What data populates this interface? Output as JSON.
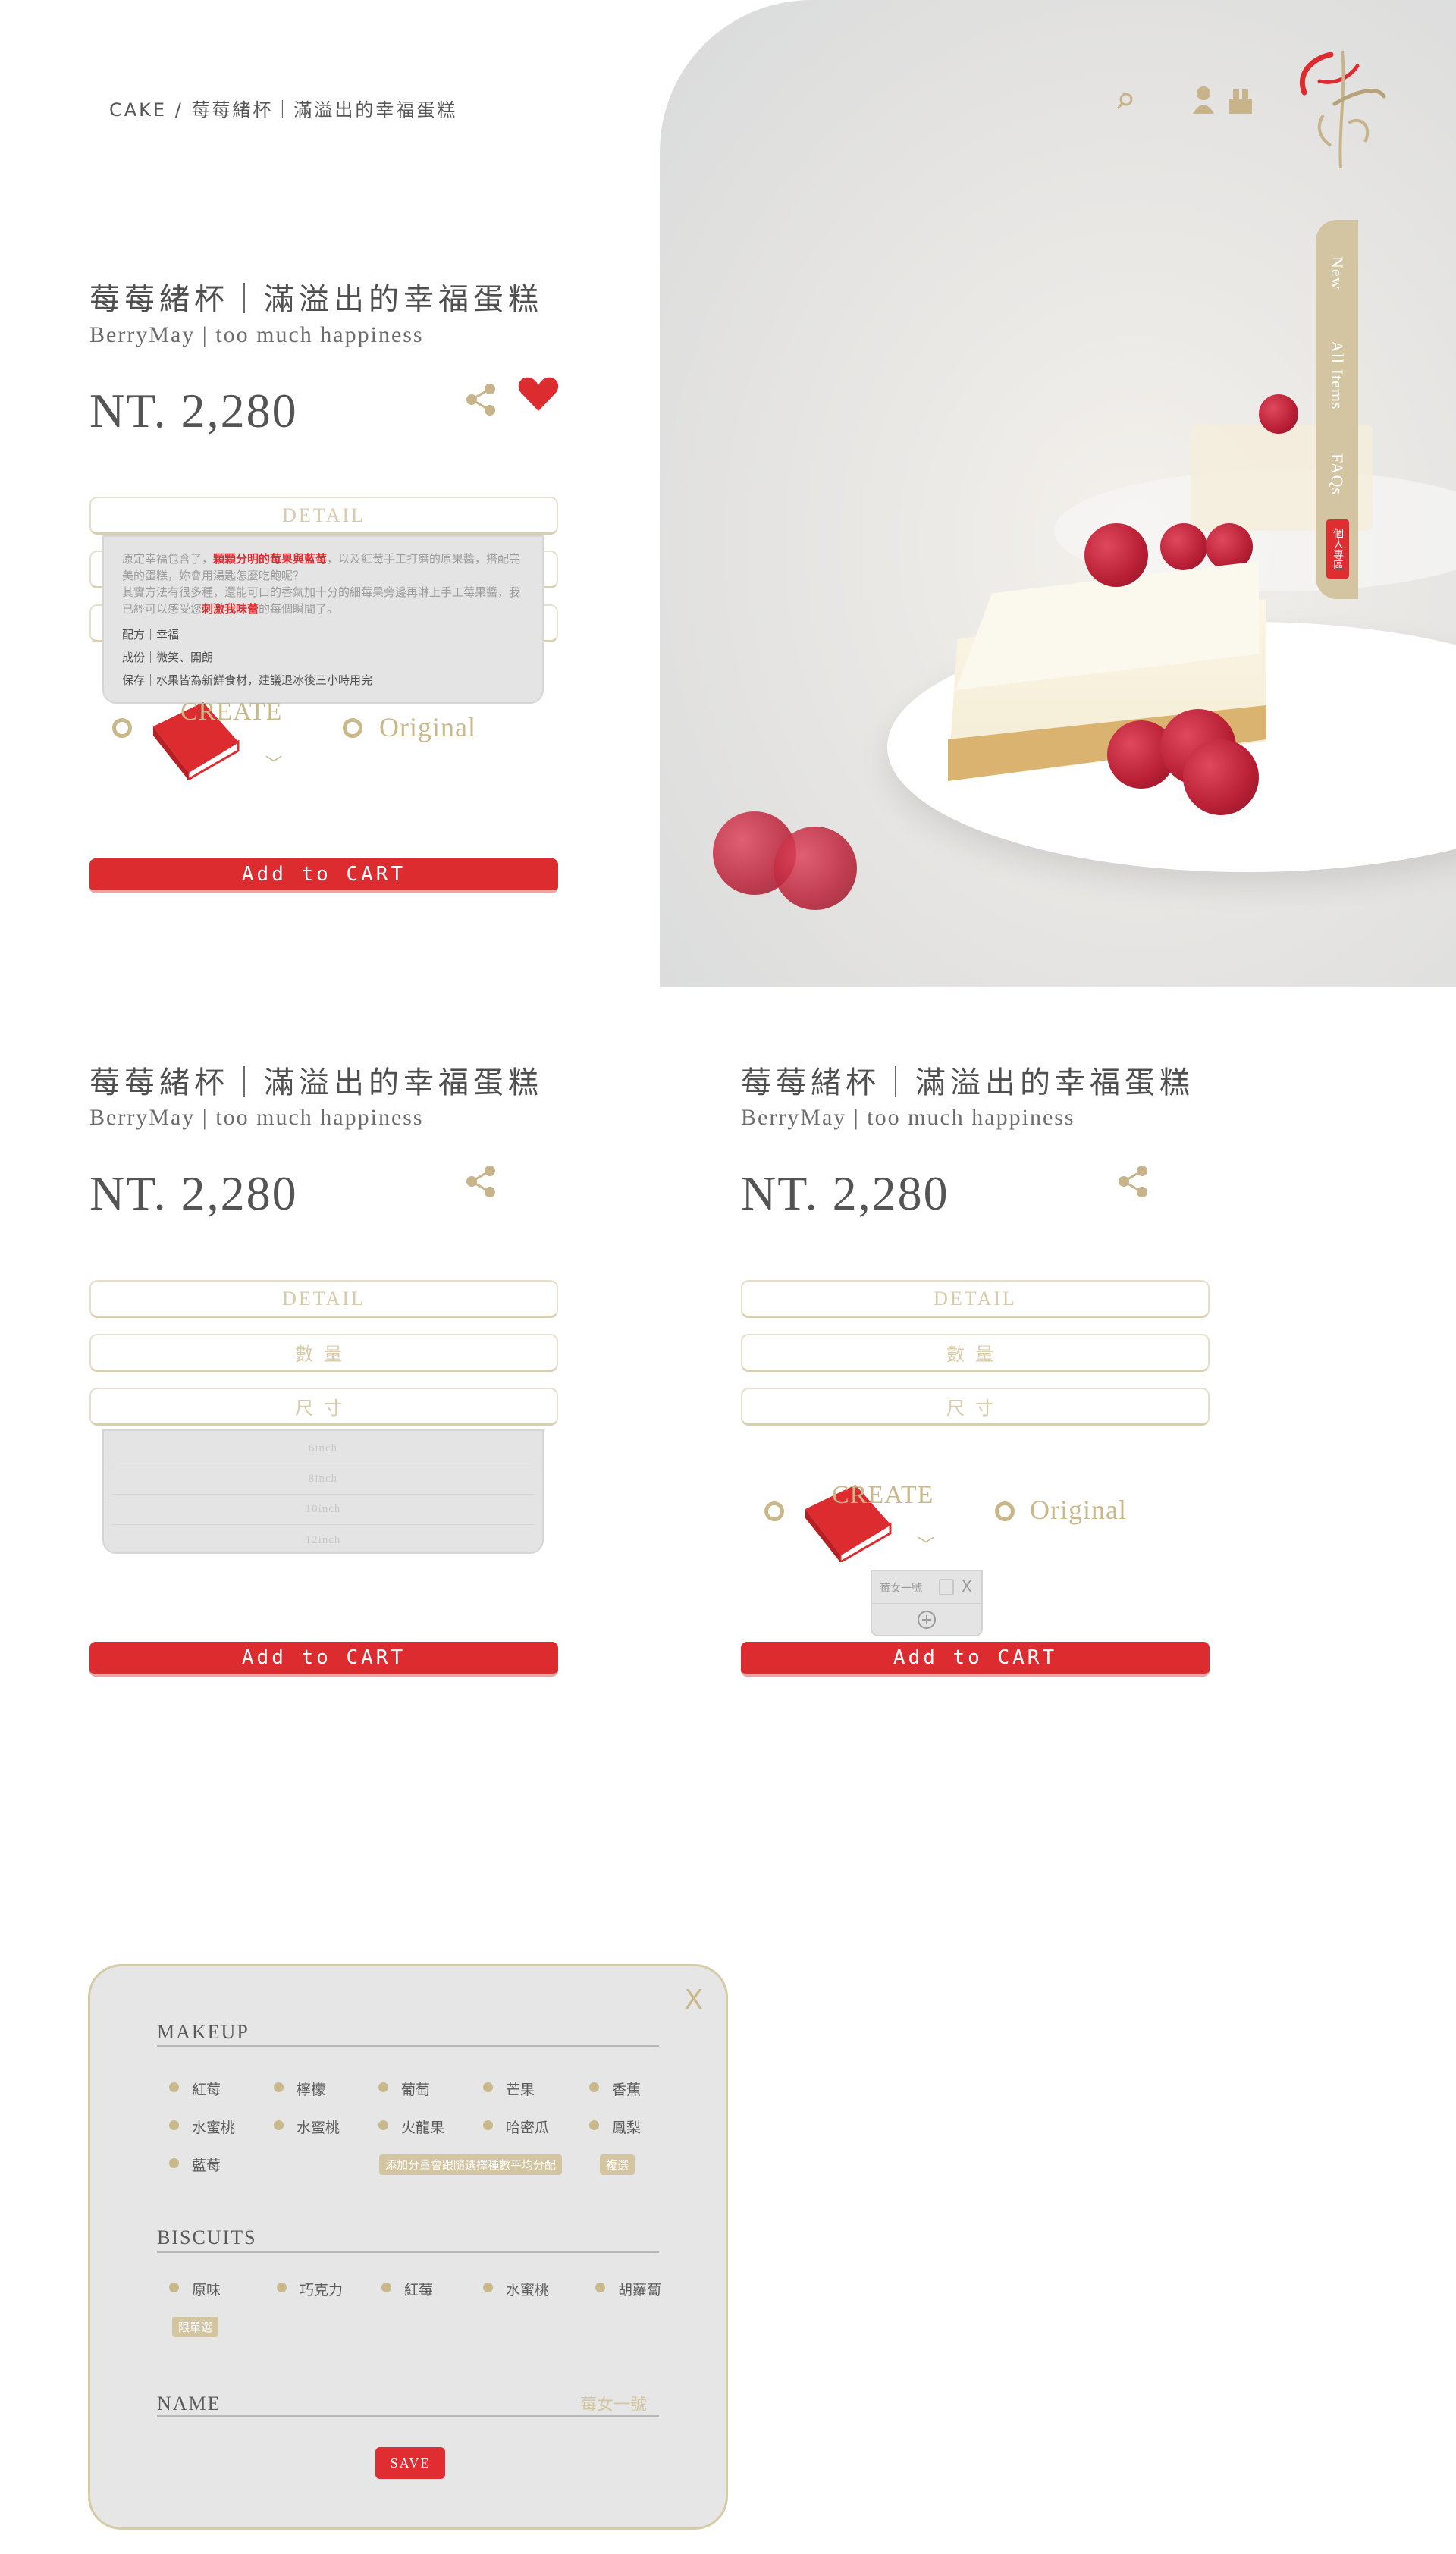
{
  "breadcrumb": "CAKE / 莓莓緒杯｜滿溢出的幸福蛋糕",
  "header": {
    "search_icon": "search-icon",
    "user_icon": "user-icon",
    "cart_icon": "cart-icon"
  },
  "sidenav": {
    "items": [
      "New",
      "All Items",
      "FAQs"
    ],
    "badge": "個人專區"
  },
  "hero": {
    "slides_total": 4
  },
  "product": {
    "title": "莓莓緒杯｜滿溢出的幸福蛋糕",
    "subtitle": "BerryMay | too much happiness",
    "price": "NT. 2,280",
    "detail_label": "DETAIL",
    "quantity_label": "數量",
    "size_label": "尺寸",
    "create_label": "CREATE",
    "original_label": "Original",
    "cart_label": "Add to CART"
  },
  "detail_popup": {
    "para1_a": "原定幸福包含了，",
    "para1_hl": "顆顆分明的莓果與藍莓",
    "para1_b": "，以及紅莓手工打磨的原果醬，搭配完美的蛋糕，妳會用湯匙怎麼吃飽呢？",
    "para2_a": "其實方法有很多種，還能可口的香氣加十分的細莓果旁邊再淋上手工莓果醬，我已經可以感受您",
    "para2_hl": "刺激我味蕾",
    "para2_b": "的每個瞬間了。",
    "recipe": "配方｜幸福",
    "ingredients": "成份｜微笑、開朗",
    "storage": "保存｜水果皆為新鮮食材，建議退冰後三小時用完"
  },
  "size_options": [
    "6inch",
    "8inch",
    "10inch",
    "12inch"
  ],
  "mini_popup": {
    "name": "莓女一號",
    "close": "X"
  },
  "editor": {
    "close": "X",
    "makeup_label": "MAKEUP",
    "makeup_row1": [
      "紅莓",
      "檸檬",
      "葡萄",
      "芒果",
      "香蕉"
    ],
    "makeup_row2": [
      "水蜜桃",
      "水蜜桃",
      "火龍果",
      "哈密瓜",
      "鳳梨"
    ],
    "makeup_row3": [
      "藍莓"
    ],
    "makeup_tag": "添加分量會跟隨選擇種數平均分配",
    "makeup_tag2": "複選",
    "biscuits_label": "BISCUITS",
    "biscuits_row": [
      "原味",
      "巧克力",
      "紅莓",
      "水蜜桃",
      "胡蘿蔔"
    ],
    "biscuits_tag": "限單選",
    "name_label": "NAME",
    "name_value": "莓女一號",
    "save_label": "SAVE"
  },
  "colors": {
    "accent": "#dd2c30",
    "gold": "#c9b88a",
    "panel": "#e6e6e6"
  }
}
